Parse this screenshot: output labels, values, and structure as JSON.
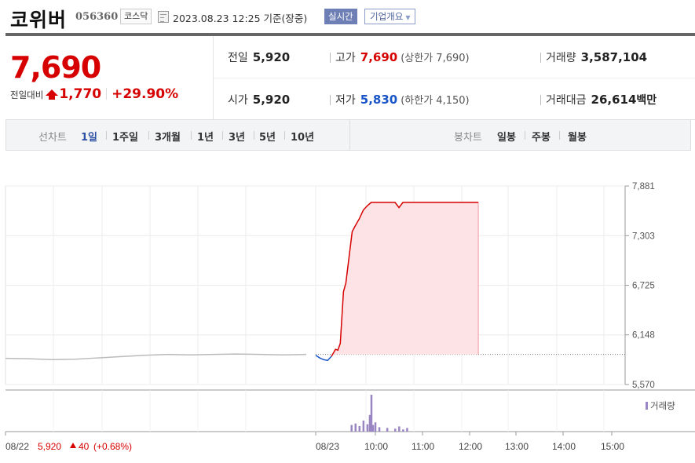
{
  "header": {
    "company": "코위버",
    "code": "056360",
    "market": "코스닥",
    "datetime": "2023.08.23 12:25 기준(장중)",
    "realtime_label": "실시간",
    "company_info_label": "기업개요"
  },
  "price": {
    "current": "7,690",
    "change_label": "전일대비",
    "change": "1,770",
    "change_pct": "+29.90%"
  },
  "stats": {
    "prev_close_label": "전일",
    "prev_close": "5,920",
    "high_label": "고가",
    "high": "7,690",
    "upper_limit_label": "(상한가 7,690)",
    "volume_label": "거래량",
    "volume": "3,587,104",
    "open_label": "시가",
    "open": "5,920",
    "low_label": "저가",
    "low": "5,830",
    "lower_limit_label": "(하한가 4,150)",
    "trade_value_label": "거래대금",
    "trade_value": "26,614",
    "trade_value_unit": "백만"
  },
  "tabs": {
    "line_label": "선차트",
    "line_items": [
      "1일",
      "1주일",
      "3개월",
      "1년",
      "3년",
      "5년",
      "10년"
    ],
    "candle_label": "봉차트",
    "candle_items": [
      "일봉",
      "주봉",
      "월봉"
    ]
  },
  "colors": {
    "up": "#d60000",
    "down": "#1a55c8",
    "prev_day_line": "#bbbbbb",
    "area_fill": "#fde3e5",
    "volume_bar": "#9a86c2"
  },
  "chart_data": {
    "type": "line",
    "x_ticks": [
      "08/22",
      "08/23",
      "10:00",
      "11:00",
      "12:00",
      "13:00",
      "14:00",
      "15:00"
    ],
    "y_ticks": [
      "7,881",
      "7,303",
      "6,725",
      "6,148",
      "5,570"
    ],
    "ylim": [
      5570,
      7881
    ],
    "reference_price": 5920,
    "prev_day_note": {
      "date": "08/22",
      "price": "5,920",
      "change": "40",
      "change_pct": "(+0.68%)"
    },
    "volume_legend": "거래량",
    "grid": true,
    "series": [
      {
        "x": [
          "08/22 09:00",
          "08/22 09:30",
          "08/22 10:00",
          "08/22 10:30",
          "08/22 11:00",
          "08/22 11:30",
          "08/22 12:00",
          "08/22 12:30",
          "08/22 13:00",
          "08/22 13:30",
          "08/22 14:00",
          "08/22 14:30",
          "08/22 15:00",
          "08/22 15:30"
        ],
        "values": [
          5875,
          5870,
          5860,
          5865,
          5880,
          5895,
          5910,
          5920,
          5915,
          5920,
          5925,
          5920,
          5915,
          5920
        ]
      },
      {
        "x": [
          "09:00",
          "09:05",
          "09:10",
          "09:15",
          "09:20",
          "09:25",
          "09:28",
          "09:31",
          "09:35",
          "09:38",
          "09:42",
          "09:46",
          "09:50",
          "09:55",
          "10:00",
          "10:05",
          "10:10",
          "10:20",
          "10:30",
          "10:40",
          "10:45",
          "10:50",
          "11:00",
          "11:30",
          "12:00",
          "12:25"
        ],
        "values": [
          5910,
          5880,
          5860,
          5850,
          5900,
          5980,
          5970,
          6050,
          6650,
          6750,
          7050,
          7350,
          7420,
          7500,
          7600,
          7650,
          7690,
          7690,
          7690,
          7690,
          7630,
          7690,
          7690,
          7690,
          7690,
          7690
        ]
      }
    ],
    "volume": {
      "x": [
        "09:45",
        "09:50",
        "09:55",
        "10:00",
        "10:05",
        "10:08",
        "10:10",
        "10:12",
        "10:15",
        "10:20",
        "10:30",
        "10:40",
        "10:45",
        "10:50",
        "10:55"
      ],
      "values": [
        18,
        22,
        15,
        30,
        20,
        45,
        100,
        18,
        25,
        12,
        10,
        8,
        14,
        6,
        10
      ]
    }
  }
}
